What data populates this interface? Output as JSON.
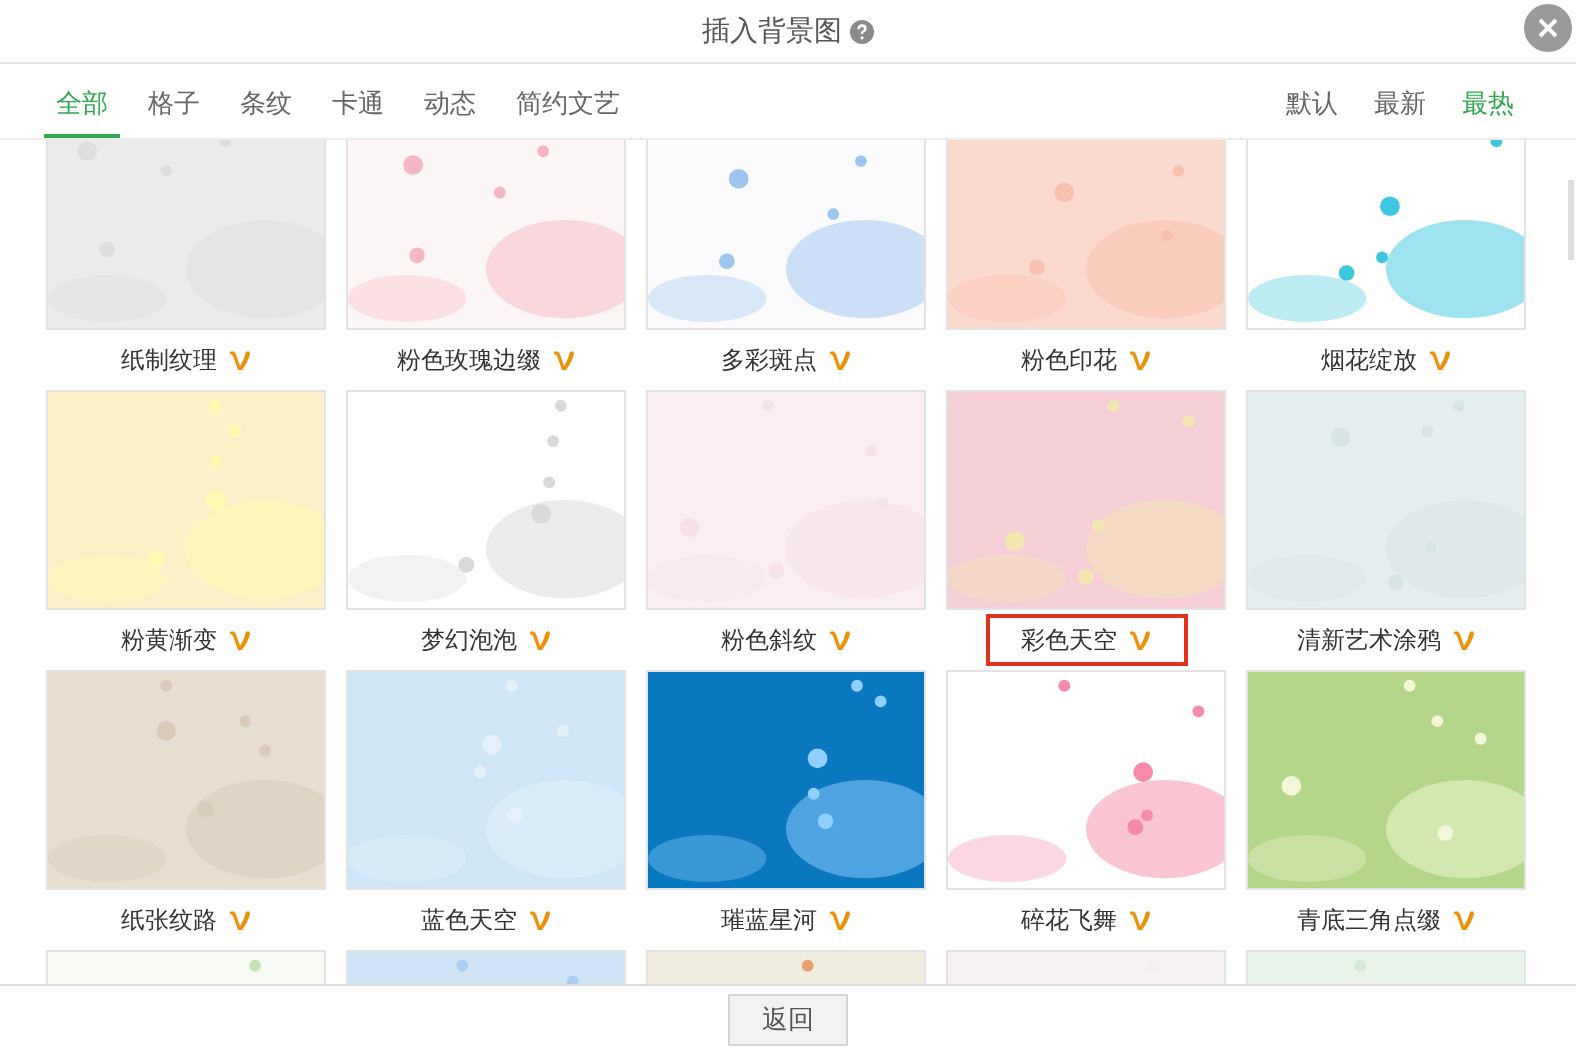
{
  "dialog": {
    "title": "插入背景图"
  },
  "categories": [
    {
      "label": "全部",
      "selected": true
    },
    {
      "label": "格子",
      "selected": false
    },
    {
      "label": "条纹",
      "selected": false
    },
    {
      "label": "卡通",
      "selected": false
    },
    {
      "label": "动态",
      "selected": false
    },
    {
      "label": "简约文艺",
      "selected": false
    }
  ],
  "sort": [
    {
      "label": "默认",
      "selected": false
    },
    {
      "label": "最新",
      "selected": false
    },
    {
      "label": "最热",
      "selected": true
    }
  ],
  "backgrounds": [
    {
      "kind": "card",
      "label": "纸制纹理",
      "selected": false
    },
    {
      "kind": "card",
      "label": "粉色玫瑰边缀",
      "selected": false
    },
    {
      "kind": "card",
      "label": "多彩斑点",
      "selected": false
    },
    {
      "kind": "card",
      "label": "粉色印花",
      "selected": false
    },
    {
      "kind": "card",
      "label": "烟花绽放",
      "selected": false
    },
    {
      "kind": "card",
      "label": "粉黄渐变",
      "selected": false
    },
    {
      "kind": "card",
      "label": "梦幻泡泡",
      "selected": false
    },
    {
      "kind": "card",
      "label": "粉色斜纹",
      "selected": false
    },
    {
      "kind": "card",
      "label": "彩色天空",
      "selected": true
    },
    {
      "kind": "card",
      "label": "清新艺术涂鸦",
      "selected": false
    },
    {
      "kind": "card",
      "label": "纸张纹路",
      "selected": false
    },
    {
      "kind": "card",
      "label": "蓝色天空",
      "selected": false
    },
    {
      "kind": "card",
      "label": "璀蓝星河",
      "selected": false
    },
    {
      "kind": "card",
      "label": "碎花飞舞",
      "selected": false
    },
    {
      "kind": "card",
      "label": "青底三角点缀",
      "selected": false
    },
    {
      "kind": "picture"
    },
    {
      "kind": "picture"
    },
    {
      "kind": "picture"
    },
    {
      "kind": "picture"
    },
    {
      "kind": "picture"
    }
  ],
  "footer": {
    "back_button": "返回"
  }
}
